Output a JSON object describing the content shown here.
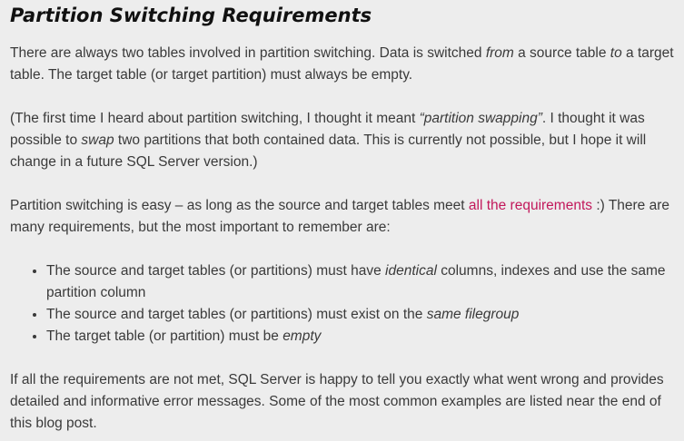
{
  "heading": "Partition Switching Requirements",
  "para1": {
    "part1": "There are always two tables involved in partition switching. Data is switched ",
    "em1": "from",
    "part2": " a source table ",
    "em2": "to",
    "part3": " a target table. The target table (or target partition) must always be empty."
  },
  "para2": {
    "part1": "(The first time I heard about partition switching, I thought it meant ",
    "em1": "“partition swapping”",
    "part2": ". I thought it was possible to ",
    "em2": "swap",
    "part3": " two partitions that both contained data. This is currently not possible, but I hope it will change in a future SQL Server version.)"
  },
  "para3": {
    "part1": "Partition switching is easy – as long as the source and target tables meet ",
    "link": "all the requirements",
    "part2": " :) There are many requirements, but the most important to remember are:"
  },
  "bullets": [
    {
      "before": "The source and target tables (or partitions) must have ",
      "em": "identical",
      "after": " columns, indexes and use the same partition column"
    },
    {
      "before": "The source and target tables (or partitions) must exist on the ",
      "em": "same filegroup",
      "after": ""
    },
    {
      "before": "The target table (or partition) must be ",
      "em": "empty",
      "after": ""
    }
  ],
  "para4": "If all the requirements are not met, SQL Server is happy to tell you exactly what went wrong and provides detailed and informative error messages. Some of the most common examples are listed near the end of this blog post.",
  "colors": {
    "background": "#ededed",
    "text": "#3a3a3a",
    "heading": "#111111",
    "link": "#c2185b"
  }
}
